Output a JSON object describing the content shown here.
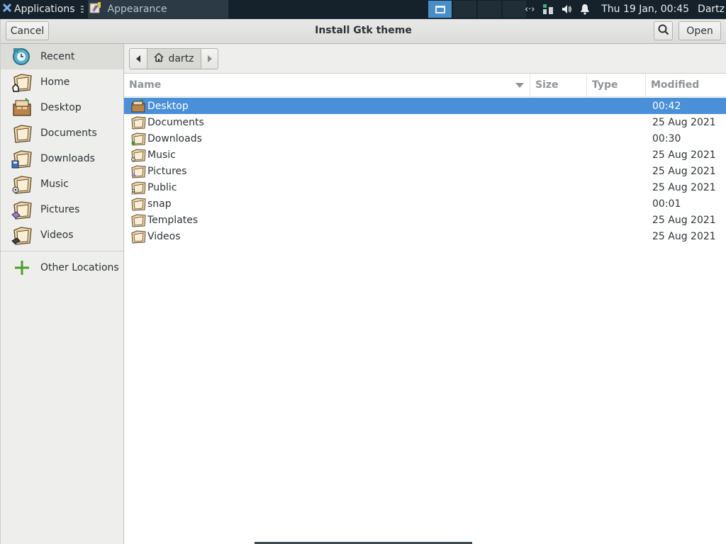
{
  "panel": {
    "applications_label": "Applications",
    "task_label": "Appearance",
    "clock": "Thu 19 Jan, 00:45",
    "user": "Dartz"
  },
  "dialog": {
    "title": "Install Gtk theme",
    "cancel_label": "Cancel",
    "open_label": "Open"
  },
  "sidebar": {
    "items": [
      {
        "label": "Recent",
        "icon": "recent-icon"
      },
      {
        "label": "Home",
        "icon": "home-folder-icon"
      },
      {
        "label": "Desktop",
        "icon": "desktop-icon"
      },
      {
        "label": "Documents",
        "icon": "documents-folder-icon"
      },
      {
        "label": "Downloads",
        "icon": "downloads-folder-icon"
      },
      {
        "label": "Music",
        "icon": "music-folder-icon"
      },
      {
        "label": "Pictures",
        "icon": "pictures-folder-icon"
      },
      {
        "label": "Videos",
        "icon": "videos-folder-icon"
      }
    ],
    "other_locations": "Other Locations"
  },
  "pathbar": {
    "crumb": "dartz"
  },
  "columns": {
    "name": "Name",
    "size": "Size",
    "type": "Type",
    "modified": "Modified"
  },
  "files": [
    {
      "name": "Desktop",
      "size": "",
      "type": "",
      "modified": "00:42"
    },
    {
      "name": "Documents",
      "size": "",
      "type": "",
      "modified": "25 Aug 2021"
    },
    {
      "name": "Downloads",
      "size": "",
      "type": "",
      "modified": "00:30"
    },
    {
      "name": "Music",
      "size": "",
      "type": "",
      "modified": "25 Aug 2021"
    },
    {
      "name": "Pictures",
      "size": "",
      "type": "",
      "modified": "25 Aug 2021"
    },
    {
      "name": "Public",
      "size": "",
      "type": "",
      "modified": "25 Aug 2021"
    },
    {
      "name": "snap",
      "size": "",
      "type": "",
      "modified": "00:01"
    },
    {
      "name": "Templates",
      "size": "",
      "type": "",
      "modified": "25 Aug 2021"
    },
    {
      "name": "Videos",
      "size": "",
      "type": "",
      "modified": "25 Aug 2021"
    }
  ],
  "colors": {
    "selection": "#4a90d9",
    "panel_bg": "#16222b",
    "sidebar_bg": "#eeeeec"
  }
}
